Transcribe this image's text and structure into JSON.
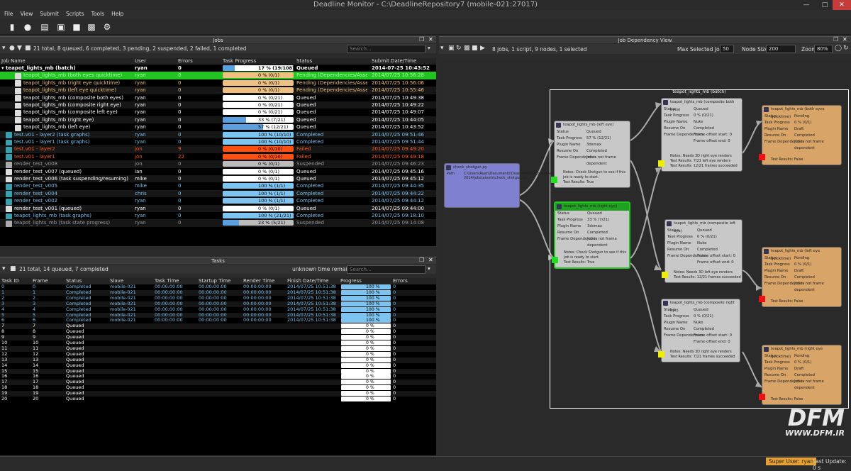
{
  "window": {
    "title": "Deadline Monitor  -  C:\\DeadlineRepository7  (mobile-021:27017)"
  },
  "menu": [
    "File",
    "View",
    "Submit",
    "Scripts",
    "Tools",
    "Help"
  ],
  "jobs_panel": {
    "title": "Jobs",
    "summary": "21 total, 8 queued, 6 completed, 3 pending, 2 suspended, 2 failed, 1 completed",
    "search_placeholder": "Search...",
    "columns": [
      "Job Name",
      "User",
      "Errors",
      "Task Progress",
      "Status",
      "Submit Date/Time"
    ],
    "rows": [
      {
        "name": "teapot_lights_mb  (batch)",
        "user": "ryan",
        "errors": "0",
        "progress": "17 %  (19/108)",
        "pct": 17,
        "status": "Queued",
        "date": "2014-07-25 10:43:52",
        "style": "batch"
      },
      {
        "name": "teapot_lights_mb   (both eyes quicktime)",
        "user": "ryan",
        "errors": "0",
        "progress": "0 %  (0/1)",
        "pct": 0,
        "status": "Pending (Dependencies/Assets)",
        "date": "2014/07/25 10:56:28",
        "style": "selected"
      },
      {
        "name": "teapot_lights_mb   (right eye quicktime)",
        "user": "ryan",
        "errors": "0",
        "progress": "0 %  (0/1)",
        "pct": 0,
        "status": "Pending (Dependencies/Assets)",
        "date": "2014/07/25 10:56:06",
        "style": "pending"
      },
      {
        "name": "teapot_lights_mb   (left eye quicktime)",
        "user": "ryan",
        "errors": "0",
        "progress": "0 %  (0/1)",
        "pct": 0,
        "status": "Pending (Dependencies/Assets)",
        "date": "2014/07/25 10:55:46",
        "style": "pending"
      },
      {
        "name": "teapot_lights_mb   (composite both eyes)",
        "user": "ryan",
        "errors": "0",
        "progress": "0 %  (0/21)",
        "pct": 0,
        "status": "Queued",
        "date": "2014/07/25 10:49:38",
        "style": "queued"
      },
      {
        "name": "teapot_lights_mb   (composite right eye)",
        "user": "ryan",
        "errors": "0",
        "progress": "0 %  (0/21)",
        "pct": 0,
        "status": "Queued",
        "date": "2014/07/25 10:49:22",
        "style": "queued"
      },
      {
        "name": "teapot_lights_mb   (composite left eye)",
        "user": "ryan",
        "errors": "0",
        "progress": "0 %  (0/21)",
        "pct": 0,
        "status": "Queued",
        "date": "2014/07/25 10:49:07",
        "style": "queued"
      },
      {
        "name": "teapot_lights_mb   (right eye)",
        "user": "ryan",
        "errors": "0",
        "progress": "33 %  (7/21)",
        "pct": 33,
        "status": "Queued",
        "date": "2014/07/25 10:44:05",
        "style": "queued"
      },
      {
        "name": "teapot_lights_mb   (left eye)",
        "user": "ryan",
        "errors": "0",
        "progress": "57 %  (12/21)",
        "pct": 57,
        "status": "Queued",
        "date": "2014/07/25 10:43:52",
        "style": "queued"
      },
      {
        "name": "test.v01 - layer2   (task graphs)",
        "user": "ryan",
        "errors": "0",
        "progress": "100 %  (10/10)",
        "pct": 100,
        "status": "Completed",
        "date": "2014/07/25 09:51:46",
        "style": "completed"
      },
      {
        "name": "test.v01 - layer1   (task graphs)",
        "user": "ryan",
        "errors": "0",
        "progress": "100 %  (10/10)",
        "pct": 100,
        "status": "Completed",
        "date": "2014/07/25 09:51:44",
        "style": "completed"
      },
      {
        "name": "test.v01 - layer2",
        "user": "jon",
        "errors": "9",
        "progress": "0 %  (0/10)",
        "pct": 0,
        "status": "Failed",
        "date": "2014/07/25 09:49:20",
        "style": "failed"
      },
      {
        "name": "test.v01 - layer1",
        "user": "jon",
        "errors": "22",
        "progress": "0 %  (0/10)",
        "pct": 0,
        "status": "Failed",
        "date": "2014/07/25 09:49:18",
        "style": "failed"
      },
      {
        "name": "render_test_v008",
        "user": "jon",
        "errors": "0",
        "progress": "0 %  (0/1)",
        "pct": 0,
        "status": "Suspended",
        "date": "2014/07/25 09:46:23",
        "style": "suspended"
      },
      {
        "name": "render_test_v007  (queued)",
        "user": "ian",
        "errors": "0",
        "progress": "0 %  (0/1)",
        "pct": 0,
        "status": "Queued",
        "date": "2014/07/25 09:45:16",
        "style": "queued"
      },
      {
        "name": "render_test_v006  (task suspending/resuming)",
        "user": "mike",
        "errors": "0",
        "progress": "0 %  (0/1)",
        "pct": 0,
        "status": "Queued",
        "date": "2014/07/25 09:45:12",
        "style": "queued"
      },
      {
        "name": "render_test_v005",
        "user": "mike",
        "errors": "0",
        "progress": "100 %  (1/1)",
        "pct": 100,
        "status": "Completed",
        "date": "2014/07/25 09:44:35",
        "style": "completed"
      },
      {
        "name": "render_test_v004",
        "user": "chris",
        "errors": "0",
        "progress": "100 %  (1/1)",
        "pct": 100,
        "status": "Completed",
        "date": "2014/07/25 09:44:22",
        "style": "completed"
      },
      {
        "name": "render_test_v002",
        "user": "ryan",
        "errors": "0",
        "progress": "100 %  (1/1)",
        "pct": 100,
        "status": "Completed",
        "date": "2014/07/25 09:44:12",
        "style": "completed"
      },
      {
        "name": "render_test_v001  (queued)",
        "user": "ryan",
        "errors": "0",
        "progress": "0 %  (0/1)",
        "pct": 0,
        "status": "Queued",
        "date": "2014/07/25 09:44:00",
        "style": "queued"
      },
      {
        "name": "teapot_lights_mb   (task graphs)",
        "user": "ryan",
        "errors": "0",
        "progress": "100 %  (21/21)",
        "pct": 100,
        "status": "Completed",
        "date": "2014/07/25 09:18:10",
        "style": "completed"
      },
      {
        "name": "teapot_lights_mb   (task state progress)",
        "user": "ryan",
        "errors": "0",
        "progress": "23 %  (5/21)",
        "pct": 23,
        "status": "Suspended",
        "date": "2014/07/25 09:14:08",
        "style": "suspended"
      }
    ]
  },
  "tasks_panel": {
    "title": "Tasks",
    "summary": "21 total, 14 queued, 7 completed",
    "remaining": "unknown time remaining",
    "search_placeholder": "Search...",
    "columns": [
      "Task ID",
      "Frame",
      "Status",
      "Slave",
      "Task Time",
      "Startup Time",
      "Render Time",
      "Finish Date/Time",
      "Progress",
      "Errors"
    ],
    "completed_template": {
      "status": "Completed",
      "slave": "mobile-021",
      "task_time": "00:00:00:00",
      "startup": "00:00:00:00",
      "render": "00:00:00:00",
      "finish": "2014/07/25 10:51:38",
      "progress": "100 %",
      "errors": "0"
    },
    "queued_template": {
      "status": "Queued",
      "progress": "0 %",
      "errors": "0"
    },
    "ids": [
      "0",
      "1",
      "2",
      "3",
      "4",
      "5",
      "6",
      "7",
      "8",
      "9",
      "10",
      "11",
      "12",
      "13",
      "14",
      "15",
      "16",
      "17",
      "18",
      "19",
      "20"
    ],
    "completed_count": 7
  },
  "dependency_panel": {
    "title": "Job Dependency View",
    "summary": "8 jobs, 1 script, 9 nodes, 1 selected",
    "max_selected_label": "Max Selected Jobs",
    "max_selected_value": "50",
    "node_size_label": "Node Size",
    "node_size_value": "200",
    "zoom_label": "Zoom",
    "zoom_value": "80%",
    "batch_label": "teapot_lights_mb  (batch)",
    "script_node": {
      "title": "check_shotgun.py",
      "path_label": "Path",
      "path_value": "C:\\Users\\Ryan\\Documents\\Deadline\\Presentations\\Siggraph 2014\\jobs\\assets\\check_shotgun.py"
    },
    "nodes": [
      {
        "id": "left",
        "title": "teapot_lights_mb   (left eye)",
        "status": "Queued",
        "progress": "57 %  (12/21)",
        "plugin": "3dsmax",
        "resume": "Completed",
        "frame_dep": "Job is not frame dependent",
        "notes": "Notes: Check Shotgun to see if this job is ready to start.",
        "tests": "Test Results: True"
      },
      {
        "id": "right",
        "title": "teapot_lights_mb   (right eye)",
        "status": "Queued",
        "progress": "33 %  (7/21)",
        "plugin": "3dsmax",
        "resume": "Completed",
        "frame_dep": "Job is not frame dependent",
        "notes": "Notes: Check Shotgun to see if this job is ready to start.",
        "tests": "Test Results: True"
      },
      {
        "id": "both",
        "title": "teapot_lights_mb   (composite both eyes)",
        "status": "Queued",
        "progress": "0 %  (0/21)",
        "plugin": "Nuke",
        "resume": "Completed",
        "frame_dep": "Frame offset start: 0 Frame offset end: 0",
        "notes": "Notes: Needs 3D right eye renders",
        "tests": "Test Results: 7/21 left eye renders",
        "tests2": "Test Results: 12/21 frames succeeded"
      },
      {
        "id": "cleft",
        "title": "teapot_lights_mb   (composite left eye)",
        "status": "Queued",
        "progress": "0 %  (0/21)",
        "plugin": "Nuke",
        "resume": "Completed",
        "frame_dep": "Frame offset start: 0 Frame offset end: 0",
        "notes": "Notes: Needs 3D left eye renders",
        "tests": "Test Results: 12/21 frames succeeded"
      },
      {
        "id": "cright",
        "title": "teapot_lights_mb   (composite right eye)",
        "status": "Queued",
        "progress": "0 %  (0/21)",
        "plugin": "Nuke",
        "resume": "Completed",
        "frame_dep": "Frame offset start: 0 Frame offset end: 0",
        "notes": "Notes: Needs 3D right eye renders",
        "tests": "Test Results: 7/21 frames succeeded"
      },
      {
        "id": "qboth",
        "title": "teapot_lights_mb   (both eyes quicktime)",
        "status": "Pending",
        "progress": "0 %  (0/1)",
        "plugin": "Draft",
        "resume": "Completed",
        "frame_dep": "Job is not frame dependent",
        "tests": "Test Results: False"
      },
      {
        "id": "qleft",
        "title": "teapot_lights_mb   (left eye quicktime)",
        "status": "Pending",
        "progress": "0 %  (0/1)",
        "plugin": "Draft",
        "resume": "Completed",
        "frame_dep": "Job is not frame dependent",
        "tests": "Test Results: False"
      },
      {
        "id": "qright",
        "title": "teapot_lights_mb   (right eye quicktime)",
        "status": "Pending",
        "progress": "0 %  (0/1)",
        "plugin": "Draft",
        "resume": "Completed",
        "frame_dep": "Job is not frame dependent",
        "tests": "Test Results: False"
      }
    ],
    "field_labels": {
      "status": "Status",
      "progress": "Task Progress",
      "plugin": "Plugin Name",
      "resume": "Resume On",
      "frame_dep": "Frame Dependencies"
    }
  },
  "watermark": {
    "brand": "DFM",
    "url": "WWW.DFM.IR"
  },
  "statusbar": {
    "user": "Super User: ryan",
    "last_update": "Last Update: 0 s"
  },
  "colors": {
    "selected": "#22c422",
    "pending": "#f0c080",
    "failed": "#ff5010",
    "completed": "#7ec4f0",
    "queued_bg": "#ffffff",
    "script_node": "#8080d0",
    "node_bg": "#c8c8c8",
    "draft_node": "#d8a468"
  }
}
